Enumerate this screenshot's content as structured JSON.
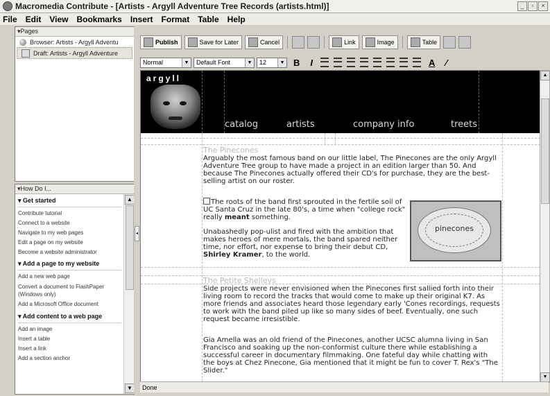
{
  "window": {
    "title": "Macromedia Contribute - [Artists - Argyll Adventure Tree Records (artists.html)]",
    "icon": "contribute-app-icon"
  },
  "menu": [
    "File",
    "Edit",
    "View",
    "Bookmarks",
    "Insert",
    "Format",
    "Table",
    "Help"
  ],
  "pages_panel": {
    "header": "▾Pages",
    "items": [
      {
        "label": "Browser: Artists - Argyll Adventu",
        "icon": "globe-icon",
        "selected": false
      },
      {
        "label": "Draft: Artists - Argyll Adventure",
        "icon": "draft-icon",
        "selected": true
      }
    ]
  },
  "howdoi_panel": {
    "header": "▾How Do I...",
    "sections": [
      {
        "title": "▾ Get started",
        "links": [
          "Contribute tutorial",
          "Connect to a website",
          "Navigate to my web pages",
          "Edit a page on my website",
          "Become a website administrator"
        ]
      },
      {
        "title": "▾ Add a page to my website",
        "links": [
          "Add a new web page",
          "Convert a document to FlashPaper (Windows only)",
          "Add a Microsoft Office document"
        ]
      },
      {
        "title": "▾ Add content to a web page",
        "links": [
          "Add an image",
          "Insert a table",
          "Insert a link",
          "Add a section anchor"
        ]
      }
    ]
  },
  "toolbar": {
    "publish": "Publish",
    "save_for_later": "Save for Later",
    "cancel": "Cancel",
    "link": "Link",
    "image": "Image",
    "table": "Table"
  },
  "format_bar": {
    "style": "Normal",
    "font": "Default Font",
    "size": "12",
    "bold": "B",
    "italic": "I"
  },
  "document": {
    "logo": "argyll",
    "nav": [
      "catalog",
      "artists",
      "company info",
      "treets"
    ],
    "section1_heading": "The Pinecones",
    "section1_p1": "Arguably the most famous band on our little label, The Pinecones are the only Argyll Adventure Tree group to have made a project in an edition larger than 50. And because The Pinecones actually offered their CD's for purchase, they are the best-selling artist on our roster.",
    "section1_p2_a": "The roots of the band first sprouted in the fertile soil of UC Santa Cruz in the late 80's, a time when \"college rock\" really ",
    "section1_p2_bold": "meant",
    "section1_p2_b": " something.",
    "section1_p3_a": "Unabashedly pop-ulist and fired with the ambition that makes heroes of mere mortals, the band spared neither time, nor effort, nor expense to bring their debut CD, ",
    "section1_p3_bold": "Shirley Kramer",
    "section1_p3_b": ", to the world.",
    "image_label": "pinecones",
    "section2_heading": "The Petite Shelleys",
    "section2_p1": "Side projects were never envisioned when the Pinecones first sallied forth into their living room to record the tracks that would come to make up their original K7. As more friends and associates heard those legendary early 'Cones recordings, requests to work with the band piled up like so many sides of beef. Eventually, one such request became irresistible.",
    "section2_p2": "Gia Amella was an old friend of the Pinecones, another UCSC alumna living in San Francisco and soaking up the non-conformist culture there while establishing a successful career in documentary filmmaking. One fateful day while chatting with the boys at Chez Pinecone, Gia mentioned that it might be fun to cover T. Rex's \"The Slider.\""
  },
  "status": "Done"
}
